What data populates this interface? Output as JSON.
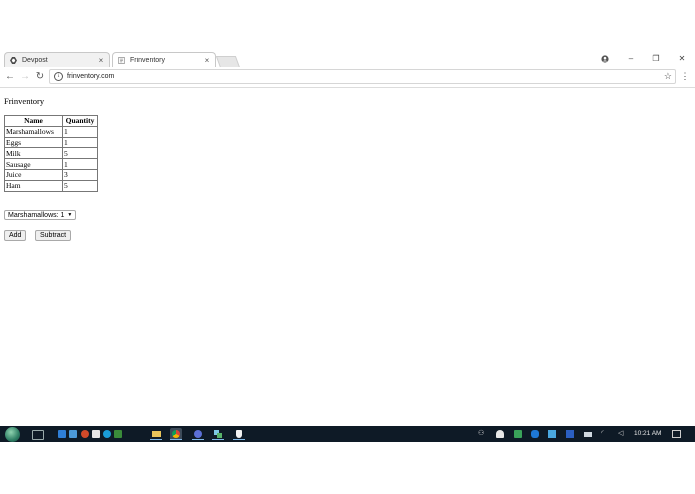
{
  "browser": {
    "tabs": [
      {
        "title": "Devpost",
        "active": false
      },
      {
        "title": "Frinventory",
        "active": true
      }
    ],
    "address": "frinventory.com"
  },
  "page": {
    "title": "Frinventory",
    "table": {
      "headers": [
        "Name",
        "Quantity"
      ],
      "rows": [
        [
          "Marshamallows",
          "1"
        ],
        [
          "Eggs",
          "1"
        ],
        [
          "Milk",
          "5"
        ],
        [
          "Sausage",
          "1"
        ],
        [
          "Juice",
          "3"
        ],
        [
          "Ham",
          "5"
        ]
      ]
    },
    "select": {
      "selected": "Marshamallows: 1"
    },
    "buttons": {
      "add": "Add",
      "subtract": "Subtract"
    }
  },
  "taskbar": {
    "clock": "10:21 AM"
  },
  "colors": {
    "taskbar_bg": "#0e1a26",
    "tab_border": "#c8c8c8"
  }
}
